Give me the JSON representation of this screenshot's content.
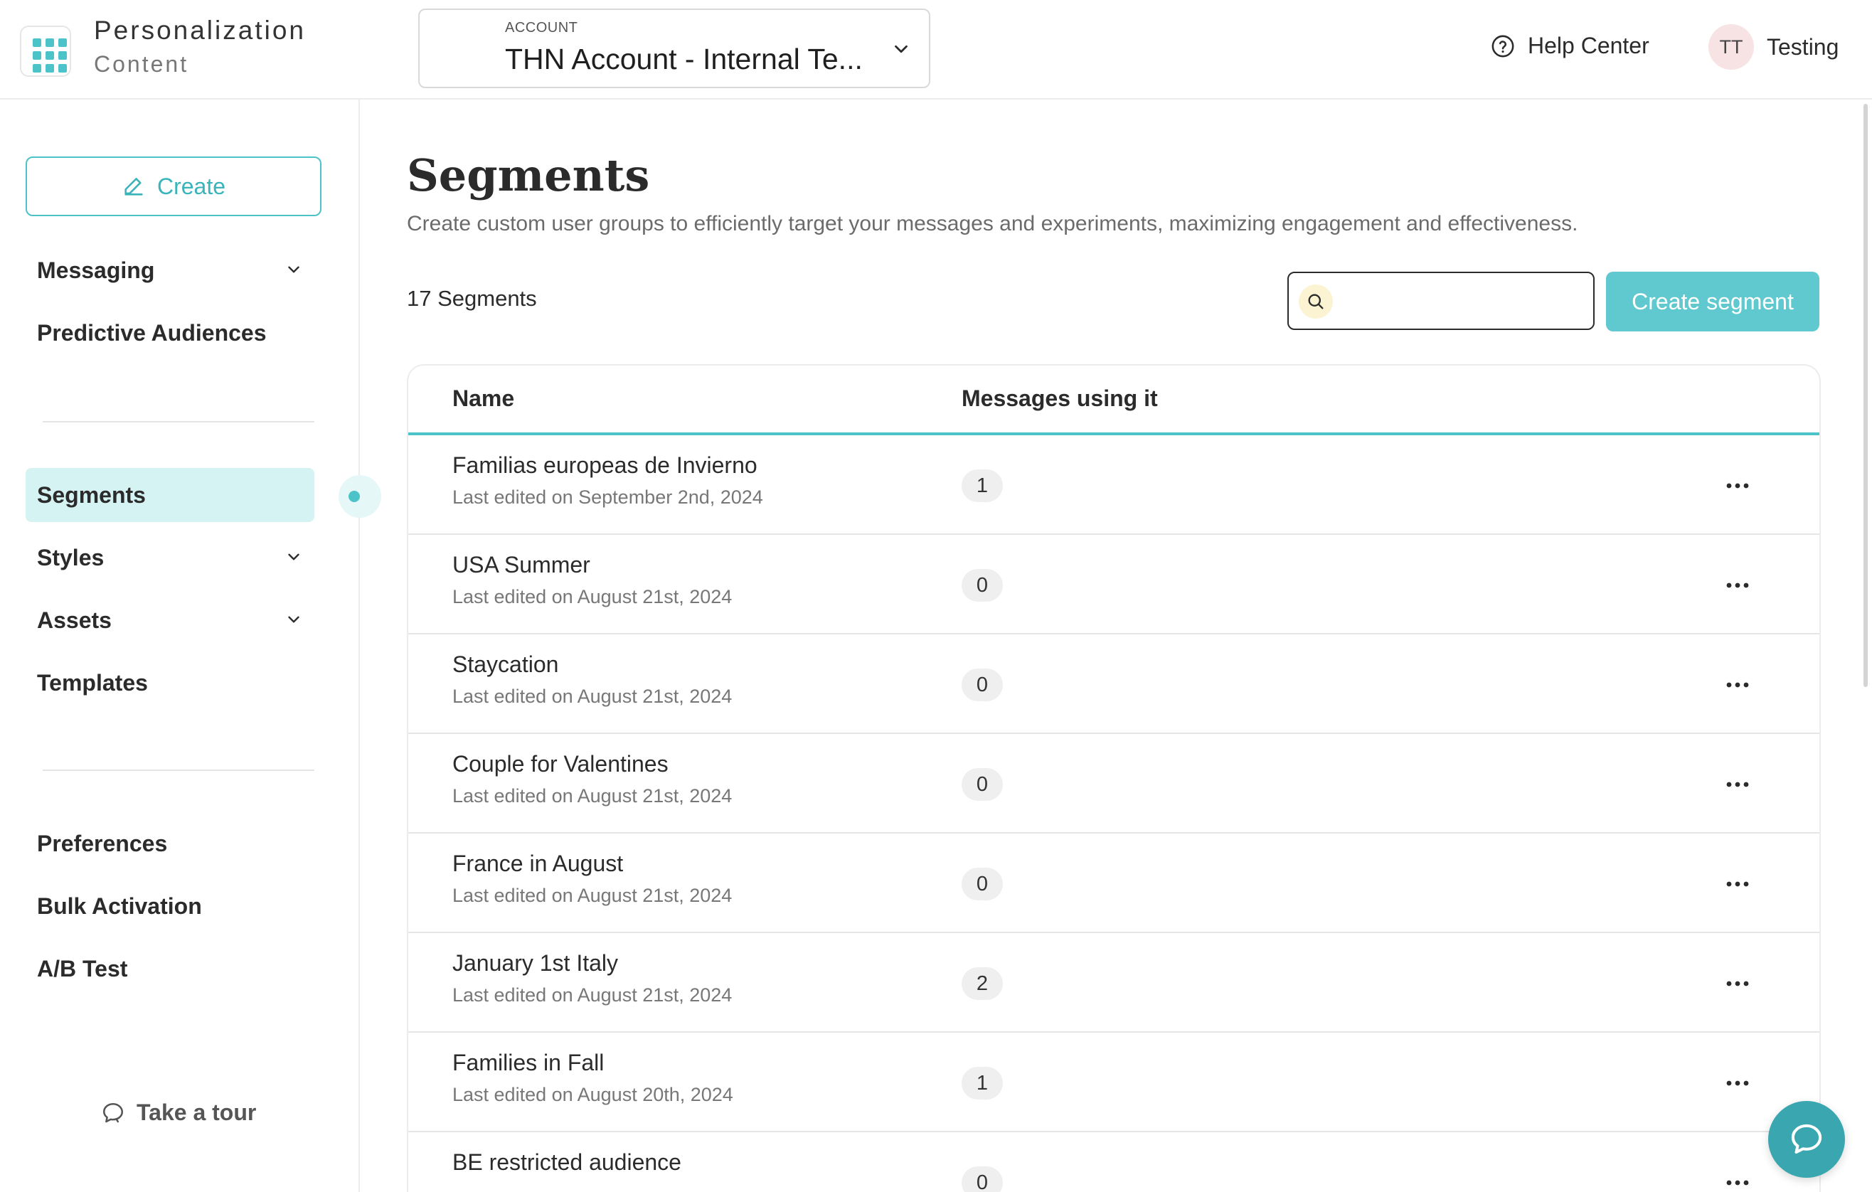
{
  "header": {
    "app_name": "Personalization",
    "app_section": "Content",
    "account_label": "ACCOUNT",
    "account_value": "THN Account - Internal Te...",
    "help_label": "Help Center",
    "user_initials": "TT",
    "user_name": "Testing"
  },
  "sidebar": {
    "create_label": "Create",
    "items": [
      {
        "label": "Messaging"
      },
      {
        "label": "Predictive Audiences"
      },
      {
        "label": "Segments"
      },
      {
        "label": "Styles"
      },
      {
        "label": "Assets"
      },
      {
        "label": "Templates"
      },
      {
        "label": "Preferences"
      },
      {
        "label": "Bulk Activation"
      },
      {
        "label": "A/B Test"
      }
    ],
    "tour_label": "Take a tour"
  },
  "main": {
    "title": "Segments",
    "description": "Create custom user groups to efficiently target your messages and experiments, maximizing engagement and effectiveness.",
    "count_label": "17 Segments",
    "search_placeholder": "",
    "create_segment_label": "Create segment",
    "columns": {
      "name": "Name",
      "messages": "Messages using it"
    },
    "rows": [
      {
        "name": "Familias europeas de Invierno",
        "edited": "Last edited on September 2nd, 2024",
        "count": "1"
      },
      {
        "name": "USA Summer",
        "edited": "Last edited on August 21st, 2024",
        "count": "0"
      },
      {
        "name": "Staycation",
        "edited": "Last edited on August 21st, 2024",
        "count": "0"
      },
      {
        "name": "Couple for Valentines",
        "edited": "Last edited on August 21st, 2024",
        "count": "0"
      },
      {
        "name": "France in August",
        "edited": "Last edited on August 21st, 2024",
        "count": "0"
      },
      {
        "name": "January 1st Italy",
        "edited": "Last edited on August 21st, 2024",
        "count": "2"
      },
      {
        "name": "Families in Fall",
        "edited": "Last edited on August 20th, 2024",
        "count": "1"
      },
      {
        "name": "BE restricted audience",
        "edited": "",
        "count": "0"
      }
    ]
  },
  "colors": {
    "accent": "#4cc3c9",
    "accent_button": "#5fc9cf",
    "active_nav_bg": "#d6f3f4",
    "chat_fab": "#3aa6b0"
  },
  "icons": [
    "app-grid-icon",
    "chevron-down-icon",
    "help-circle-icon",
    "pencil-icon",
    "search-icon",
    "more-horizontal-icon",
    "chat-bubble-icon",
    "tour-bubble-icon"
  ]
}
